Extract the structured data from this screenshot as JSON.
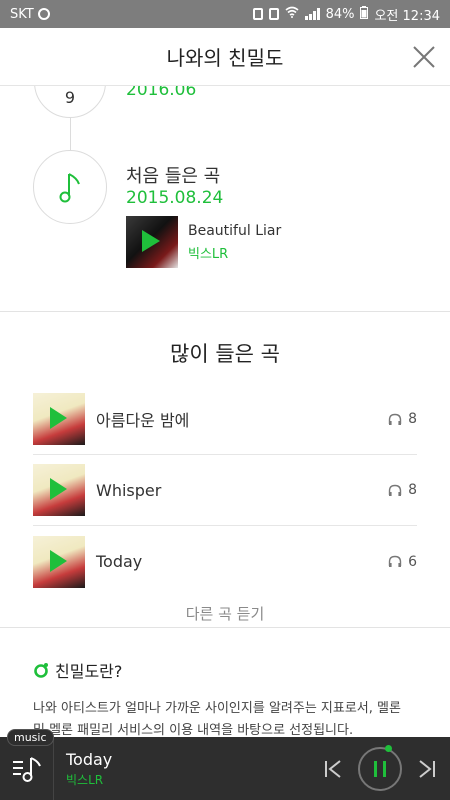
{
  "status_bar": {
    "carrier": "SKT",
    "battery": "84%",
    "time": "오전 12:34"
  },
  "header": {
    "title": "나와의 친밀도"
  },
  "timeline": {
    "prev_step_number": "9",
    "prev_date": "2016.06",
    "first_label": "처음 들은 곡",
    "first_date": "2015.08.24",
    "first_song": {
      "title": "Beautiful Liar",
      "artist": "빅스LR"
    }
  },
  "most_played": {
    "title": "많이 들은 곡",
    "items": [
      {
        "title": "아름다운 밤에",
        "plays": "8"
      },
      {
        "title": "Whisper",
        "plays": "8"
      },
      {
        "title": "Today",
        "plays": "6"
      }
    ],
    "more_label": "다른 곡 듣기"
  },
  "about": {
    "title": "친밀도란?",
    "text": "나와 아티스트가 얼마나 가까운 사이인지를 알려주는 지표로서, 멜론 및 멜론 패밀리 서비스의 이용 내역을 바탕으로 선정됩니다."
  },
  "player": {
    "badge": "music",
    "title": "Today",
    "artist": "빅스LR"
  },
  "colors": {
    "accent": "#1fbf3b",
    "player_bg": "#2e2e2e",
    "status_bg": "#7d7d7d"
  }
}
